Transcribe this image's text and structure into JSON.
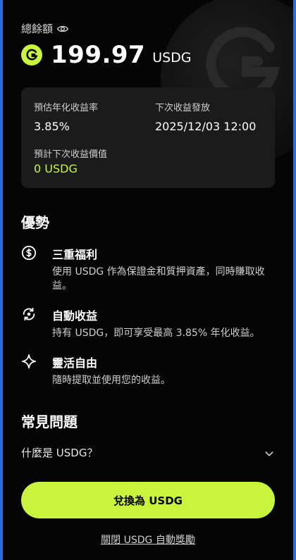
{
  "balance": {
    "label": "總餘額",
    "amount": "199.97",
    "unit": "USDG"
  },
  "card": {
    "apy_label": "預估年化收益率",
    "apy_value": "3.85%",
    "next_label": "下次收益發放",
    "next_value": "2025/12/03 12:00",
    "est_label": "預計下次收益價值",
    "est_value": "0 USDG"
  },
  "advantages": {
    "title": "優勢",
    "items": [
      {
        "title": "三重福利",
        "desc": "使用 USDG 作為保證金和質押資產，同時賺取收益。"
      },
      {
        "title": "自動收益",
        "desc": "持有 USDG，即可享受最高 3.85% 年化收益。"
      },
      {
        "title": "靈活自由",
        "desc": "隨時提取並使用您的收益。"
      }
    ]
  },
  "faq": {
    "title": "常見問題",
    "q1": "什麼是 USDG？"
  },
  "cta": {
    "label": "兌換為 USDG"
  },
  "footer_link": "關閉 USDG 自動獎勵",
  "colors": {
    "accent": "#c8f53b",
    "card_bg": "#1b1b1b"
  }
}
